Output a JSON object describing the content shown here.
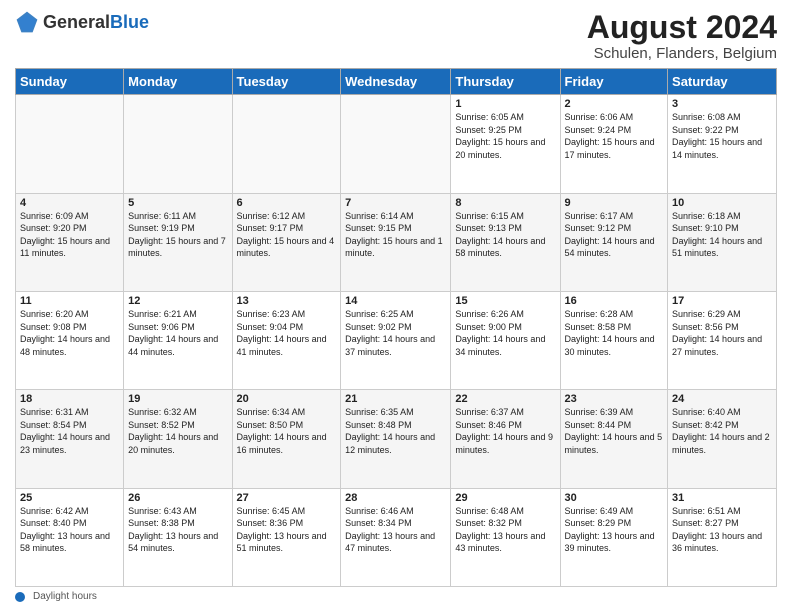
{
  "header": {
    "logo_general": "General",
    "logo_blue": "Blue",
    "title": "August 2024",
    "subtitle": "Schulen, Flanders, Belgium"
  },
  "days_of_week": [
    "Sunday",
    "Monday",
    "Tuesday",
    "Wednesday",
    "Thursday",
    "Friday",
    "Saturday"
  ],
  "weeks": [
    [
      {
        "day": "",
        "info": ""
      },
      {
        "day": "",
        "info": ""
      },
      {
        "day": "",
        "info": ""
      },
      {
        "day": "",
        "info": ""
      },
      {
        "day": "1",
        "info": "Sunrise: 6:05 AM\nSunset: 9:25 PM\nDaylight: 15 hours and 20 minutes."
      },
      {
        "day": "2",
        "info": "Sunrise: 6:06 AM\nSunset: 9:24 PM\nDaylight: 15 hours and 17 minutes."
      },
      {
        "day": "3",
        "info": "Sunrise: 6:08 AM\nSunset: 9:22 PM\nDaylight: 15 hours and 14 minutes."
      }
    ],
    [
      {
        "day": "4",
        "info": "Sunrise: 6:09 AM\nSunset: 9:20 PM\nDaylight: 15 hours and 11 minutes."
      },
      {
        "day": "5",
        "info": "Sunrise: 6:11 AM\nSunset: 9:19 PM\nDaylight: 15 hours and 7 minutes."
      },
      {
        "day": "6",
        "info": "Sunrise: 6:12 AM\nSunset: 9:17 PM\nDaylight: 15 hours and 4 minutes."
      },
      {
        "day": "7",
        "info": "Sunrise: 6:14 AM\nSunset: 9:15 PM\nDaylight: 15 hours and 1 minute."
      },
      {
        "day": "8",
        "info": "Sunrise: 6:15 AM\nSunset: 9:13 PM\nDaylight: 14 hours and 58 minutes."
      },
      {
        "day": "9",
        "info": "Sunrise: 6:17 AM\nSunset: 9:12 PM\nDaylight: 14 hours and 54 minutes."
      },
      {
        "day": "10",
        "info": "Sunrise: 6:18 AM\nSunset: 9:10 PM\nDaylight: 14 hours and 51 minutes."
      }
    ],
    [
      {
        "day": "11",
        "info": "Sunrise: 6:20 AM\nSunset: 9:08 PM\nDaylight: 14 hours and 48 minutes."
      },
      {
        "day": "12",
        "info": "Sunrise: 6:21 AM\nSunset: 9:06 PM\nDaylight: 14 hours and 44 minutes."
      },
      {
        "day": "13",
        "info": "Sunrise: 6:23 AM\nSunset: 9:04 PM\nDaylight: 14 hours and 41 minutes."
      },
      {
        "day": "14",
        "info": "Sunrise: 6:25 AM\nSunset: 9:02 PM\nDaylight: 14 hours and 37 minutes."
      },
      {
        "day": "15",
        "info": "Sunrise: 6:26 AM\nSunset: 9:00 PM\nDaylight: 14 hours and 34 minutes."
      },
      {
        "day": "16",
        "info": "Sunrise: 6:28 AM\nSunset: 8:58 PM\nDaylight: 14 hours and 30 minutes."
      },
      {
        "day": "17",
        "info": "Sunrise: 6:29 AM\nSunset: 8:56 PM\nDaylight: 14 hours and 27 minutes."
      }
    ],
    [
      {
        "day": "18",
        "info": "Sunrise: 6:31 AM\nSunset: 8:54 PM\nDaylight: 14 hours and 23 minutes."
      },
      {
        "day": "19",
        "info": "Sunrise: 6:32 AM\nSunset: 8:52 PM\nDaylight: 14 hours and 20 minutes."
      },
      {
        "day": "20",
        "info": "Sunrise: 6:34 AM\nSunset: 8:50 PM\nDaylight: 14 hours and 16 minutes."
      },
      {
        "day": "21",
        "info": "Sunrise: 6:35 AM\nSunset: 8:48 PM\nDaylight: 14 hours and 12 minutes."
      },
      {
        "day": "22",
        "info": "Sunrise: 6:37 AM\nSunset: 8:46 PM\nDaylight: 14 hours and 9 minutes."
      },
      {
        "day": "23",
        "info": "Sunrise: 6:39 AM\nSunset: 8:44 PM\nDaylight: 14 hours and 5 minutes."
      },
      {
        "day": "24",
        "info": "Sunrise: 6:40 AM\nSunset: 8:42 PM\nDaylight: 14 hours and 2 minutes."
      }
    ],
    [
      {
        "day": "25",
        "info": "Sunrise: 6:42 AM\nSunset: 8:40 PM\nDaylight: 13 hours and 58 minutes."
      },
      {
        "day": "26",
        "info": "Sunrise: 6:43 AM\nSunset: 8:38 PM\nDaylight: 13 hours and 54 minutes."
      },
      {
        "day": "27",
        "info": "Sunrise: 6:45 AM\nSunset: 8:36 PM\nDaylight: 13 hours and 51 minutes."
      },
      {
        "day": "28",
        "info": "Sunrise: 6:46 AM\nSunset: 8:34 PM\nDaylight: 13 hours and 47 minutes."
      },
      {
        "day": "29",
        "info": "Sunrise: 6:48 AM\nSunset: 8:32 PM\nDaylight: 13 hours and 43 minutes."
      },
      {
        "day": "30",
        "info": "Sunrise: 6:49 AM\nSunset: 8:29 PM\nDaylight: 13 hours and 39 minutes."
      },
      {
        "day": "31",
        "info": "Sunrise: 6:51 AM\nSunset: 8:27 PM\nDaylight: 13 hours and 36 minutes."
      }
    ]
  ],
  "footer": {
    "label": "Daylight hours"
  }
}
